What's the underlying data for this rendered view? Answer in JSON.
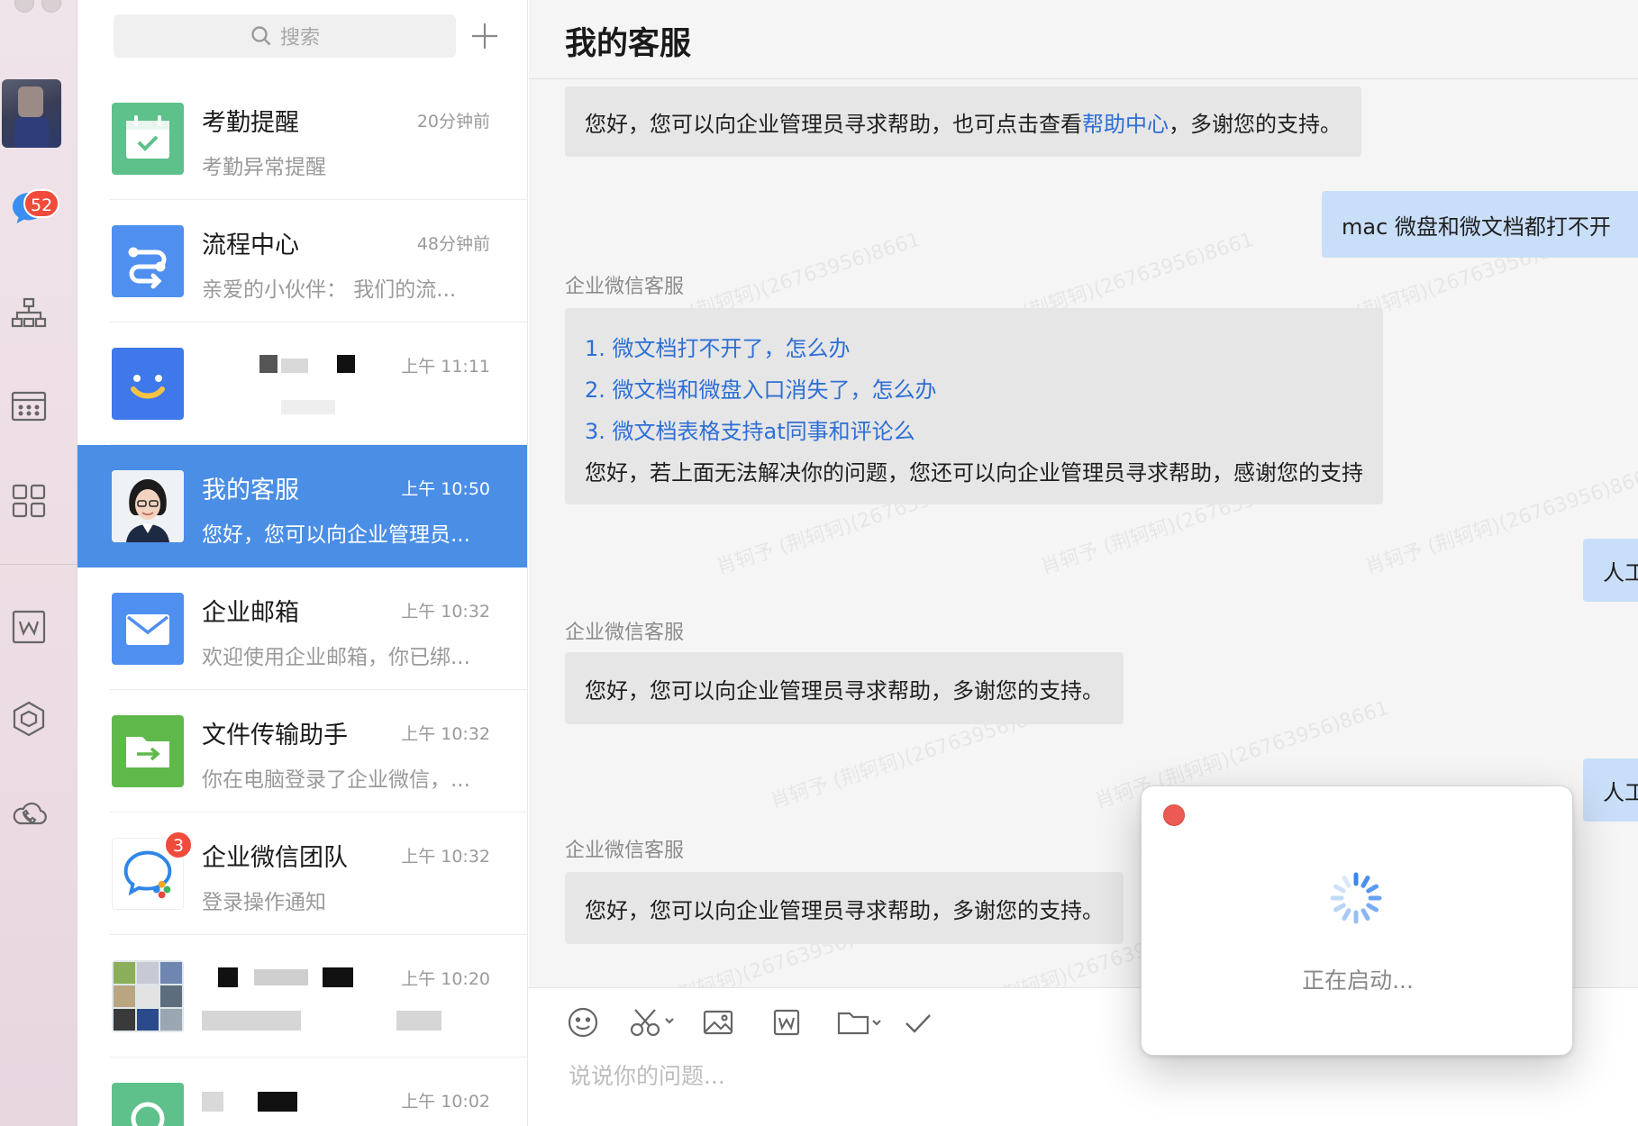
{
  "search": {
    "placeholder": "搜索"
  },
  "rail": {
    "unread_badge": "52"
  },
  "chats": [
    {
      "name": "考勤提醒",
      "time": "20分钟前",
      "preview": "考勤异常提醒",
      "icon": "calendar-check-icon"
    },
    {
      "name": "流程中心",
      "time": "48分钟前",
      "preview": "亲爱的小伙伴：  我们的流...",
      "icon": "workflow-icon"
    },
    {
      "name": "",
      "time": "上午 11:11",
      "preview": "",
      "icon": "smile-app-icon"
    },
    {
      "name": "我的客服",
      "time": "上午 10:50",
      "preview": "您好，您可以向企业管理员...",
      "icon": "agent-avatar"
    },
    {
      "name": "企业邮箱",
      "time": "上午 10:32",
      "preview": "欢迎使用企业邮箱，你已绑...",
      "icon": "mail-icon"
    },
    {
      "name": "文件传输助手",
      "time": "上午 10:32",
      "preview": "你在电脑登录了企业微信，...",
      "icon": "file-transfer-icon"
    },
    {
      "name": "企业微信团队",
      "time": "上午 10:32",
      "preview": "登录操作通知",
      "icon": "wecom-team-icon",
      "badge": "3"
    },
    {
      "name": "",
      "time": "上午 10:20",
      "preview": "",
      "icon": "group-avatar"
    },
    {
      "name": "",
      "time": "上午 10:02",
      "preview": "",
      "icon": "green-app-icon"
    }
  ],
  "conversation": {
    "title": "我的客服",
    "messages": [
      {
        "pre": "您好，您可以向企业管理员寻求帮助，也可点击查看",
        "link": "帮助中心",
        "post": "，多谢您的支持。"
      },
      {
        "text": "mac 微盘和微文档都打不开"
      },
      {
        "sender": "企业微信客服",
        "links": [
          "1. 微文档打不开了，怎么办",
          "2. 微文档和微盘入口消失了，怎么办",
          "3. 微文档表格支持at同事和评论么"
        ],
        "text": "您好，若上面无法解决你的问题，您还可以向企业管理员寻求帮助，感谢您的支持"
      },
      {
        "text": "人工"
      },
      {
        "sender": "企业微信客服",
        "text": "您好，您可以向企业管理员寻求帮助，多谢您的支持。"
      },
      {
        "text": "人工"
      },
      {
        "sender": "企业微信客服",
        "text": "您好，您可以向企业管理员寻求帮助，多谢您的支持。"
      }
    ],
    "watermark": "肖轲予 (荆轲轲)(26763956)8661"
  },
  "composer": {
    "placeholder": "说说你的问题..."
  },
  "dialog": {
    "status": "正在启动..."
  },
  "colors": {
    "accent": "#4a8ee6",
    "badge": "#f04b3b",
    "link": "#2d6fd6"
  }
}
